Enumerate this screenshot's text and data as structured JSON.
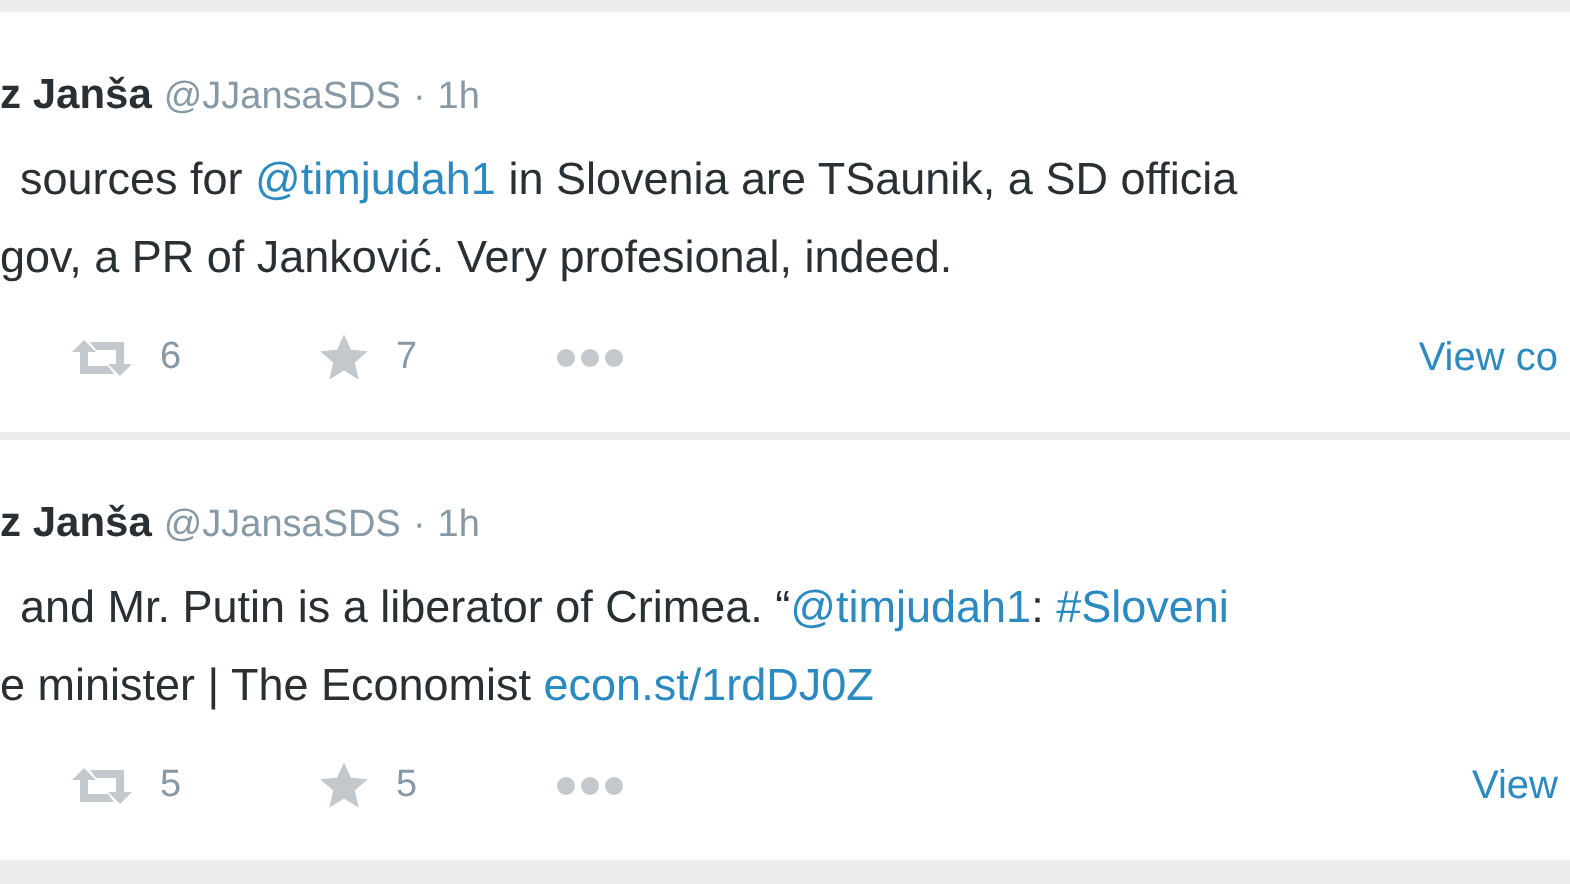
{
  "tweets": [
    {
      "author": "z Janša",
      "handle": "@JJansaSDS",
      "separator": "·",
      "time": "1h",
      "lines": [
        [
          {
            "kind": "text",
            "text": "sources for "
          },
          {
            "kind": "mention",
            "text": "@timjudah1"
          },
          {
            "kind": "text",
            "text": " in Slovenia are TSaunik, a SD officia"
          }
        ],
        [
          {
            "kind": "text",
            "text": "gov, a PR of Janković. Very profesional, indeed."
          }
        ]
      ],
      "retweets": "6",
      "favorites": "7",
      "view_link": "View co"
    },
    {
      "author": "z Janša",
      "handle": "@JJansaSDS",
      "separator": "·",
      "time": "1h",
      "lines": [
        [
          {
            "kind": "text",
            "text": "and Mr. Putin is a liberator of Crimea. “"
          },
          {
            "kind": "mention",
            "text": "@timjudah1"
          },
          {
            "kind": "text",
            "text": ": "
          },
          {
            "kind": "hashtag",
            "text": "#Sloveni"
          }
        ],
        [
          {
            "kind": "text",
            "text": "e minister | The Economist "
          },
          {
            "kind": "link",
            "text": "econ.st/1rdDJ0Z"
          }
        ]
      ],
      "retweets": "5",
      "favorites": "5",
      "view_link": "View"
    }
  ]
}
